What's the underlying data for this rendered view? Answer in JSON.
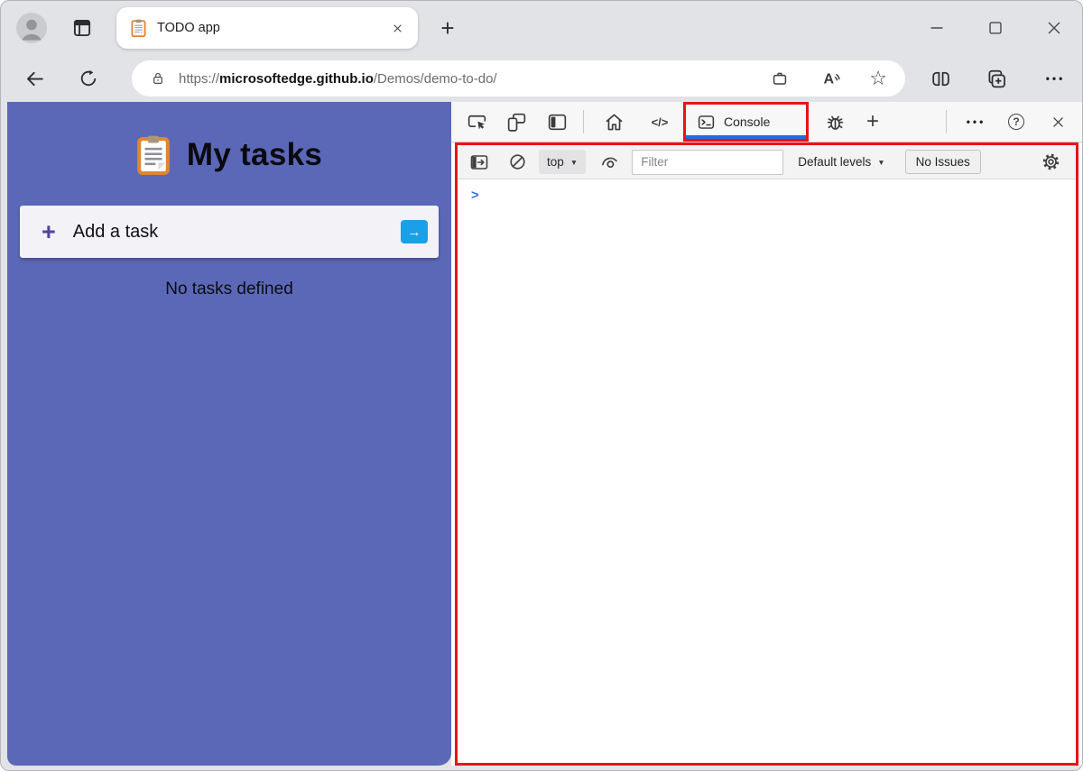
{
  "browser": {
    "tab": {
      "title": "TODO app"
    },
    "new_tab_label": "+",
    "url": {
      "scheme": "https://",
      "host": "microsoftedge.github.io",
      "path": "/Demos/demo-to-do/"
    },
    "more_menu": "•••"
  },
  "app": {
    "title": "My tasks",
    "add_task": {
      "plus_icon": "+",
      "label": "Add a task",
      "submit_icon": "→"
    },
    "empty_state": "No tasks defined"
  },
  "devtools": {
    "console_tab_label": "Console",
    "elements_glyph": "</>",
    "add_panel_label": "+",
    "more_menu": "•••",
    "help_glyph": "?",
    "toolbar": {
      "context_selector": "top",
      "caret": "▼",
      "filter_placeholder": "Filter",
      "levels_label": "Default levels",
      "issues_badge": "No Issues"
    },
    "console_prompt": ">"
  },
  "icons": {
    "star": "☆"
  },
  "colors": {
    "highlight_red": "#ee1111",
    "active_tab_blue": "#1a6fe0",
    "app_background": "#5b68b7",
    "submit_button_blue": "#1aa0e6",
    "add_plus_purple": "#514399"
  }
}
